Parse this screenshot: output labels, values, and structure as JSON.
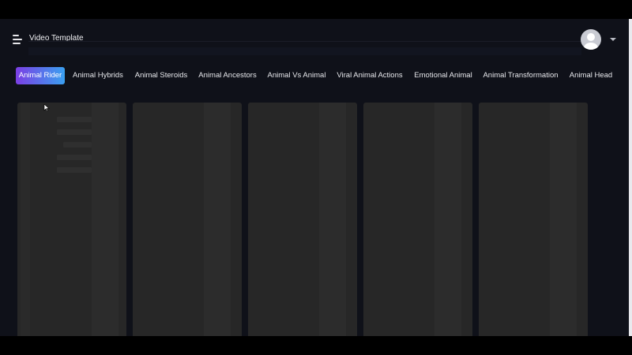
{
  "header": {
    "title": "Video Template",
    "menu_icon": "hamburger-menu-icon",
    "avatar_icon": "user-avatar-icon",
    "dropdown_icon": "caret-down-icon"
  },
  "tabs": {
    "active_index": 0,
    "items": [
      {
        "label": "Animal Rider"
      },
      {
        "label": "Animal Hybrids"
      },
      {
        "label": "Animal Steroids"
      },
      {
        "label": "Animal Ancestors"
      },
      {
        "label": "Animal Vs Animal"
      },
      {
        "label": "Viral Animal Actions"
      },
      {
        "label": "Emotional Animal"
      },
      {
        "label": "Animal Transformation"
      },
      {
        "label": "Animal Head"
      }
    ]
  },
  "cards": {
    "count": 5,
    "state": "loading-placeholder"
  },
  "colors": {
    "background": "#0f1119",
    "card": "#272727",
    "active_tab_gradient_start": "#7b3fe4",
    "active_tab_gradient_end": "#3aa0f0",
    "text": "#e7e8ec"
  }
}
